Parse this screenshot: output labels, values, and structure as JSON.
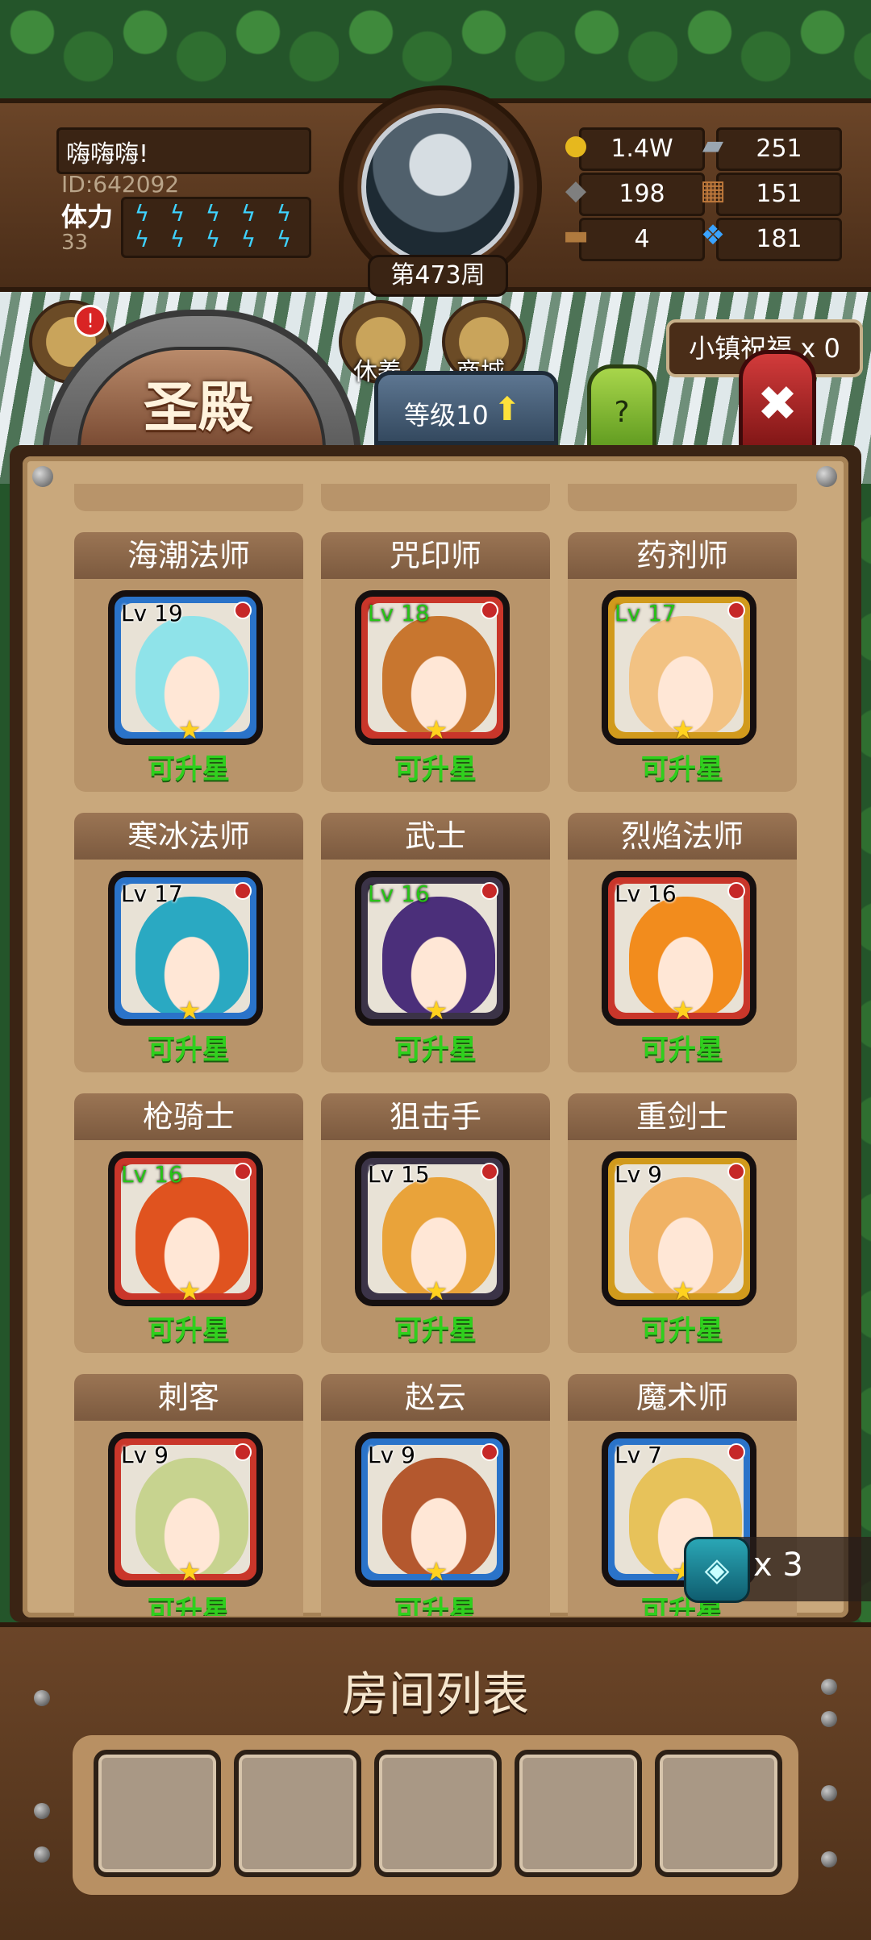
{
  "player": {
    "name": "嗨嗨嗨!",
    "id": "ID:642092",
    "stamina_label": "体力",
    "stamina_value": "33",
    "week_label": "第473周"
  },
  "resources": [
    {
      "icon": "gold-coin-icon",
      "value": "1.4W"
    },
    {
      "icon": "iron-ingot-icon",
      "value": "251"
    },
    {
      "icon": "ore-stone-icon",
      "value": "198"
    },
    {
      "icon": "leather-icon",
      "value": "151"
    },
    {
      "icon": "wood-log-icon",
      "value": "4"
    },
    {
      "icon": "blue-crystal-icon",
      "value": "181"
    }
  ],
  "shortcuts": [
    {
      "icon": "compass-icon",
      "label": "",
      "badge": "!"
    },
    {
      "icon": "scroll-icon",
      "label": "休养"
    },
    {
      "icon": "shop-icon",
      "label": "商城"
    }
  ],
  "blessing": {
    "label": "小镇祝福 x 0"
  },
  "title": "圣殿",
  "level_tab": {
    "label": "等级10"
  },
  "help": {
    "label": "?"
  },
  "close": {
    "label": "✖"
  },
  "heroes": [
    {
      "name": "海潮法师",
      "level": "Lv 19",
      "status": "可升星",
      "frame": "blue",
      "hair": "#8fe3e9",
      "lv_green": false
    },
    {
      "name": "咒印师",
      "level": "Lv 18",
      "status": "可升星",
      "frame": "red",
      "hair": "#c8762f",
      "lv_green": true
    },
    {
      "name": "药剂师",
      "level": "Lv 17",
      "status": "可升星",
      "frame": "gold",
      "hair": "#f2c283",
      "lv_green": true
    },
    {
      "name": "寒冰法师",
      "level": "Lv 17",
      "status": "可升星",
      "frame": "blue",
      "hair": "#2aa9c2",
      "lv_green": false
    },
    {
      "name": "武士",
      "level": "Lv 16",
      "status": "可升星",
      "frame": "purple",
      "hair": "#4b2f7a",
      "lv_green": true
    },
    {
      "name": "烈焰法师",
      "level": "Lv 16",
      "status": "可升星",
      "frame": "red",
      "hair": "#f28c1d",
      "lv_green": false
    },
    {
      "name": "枪骑士",
      "level": "Lv 16",
      "status": "可升星",
      "frame": "red",
      "hair": "#e0531f",
      "lv_green": true
    },
    {
      "name": "狙击手",
      "level": "Lv 15",
      "status": "可升星",
      "frame": "purple",
      "hair": "#e9a33a",
      "lv_green": false
    },
    {
      "name": "重剑士",
      "level": "Lv 9",
      "status": "可升星",
      "frame": "gold",
      "hair": "#f0b264",
      "lv_green": false
    },
    {
      "name": "刺客",
      "level": "Lv 9",
      "status": "可升星",
      "frame": "red",
      "hair": "#c7d38f",
      "lv_green": false
    },
    {
      "name": "赵云",
      "level": "Lv 9",
      "status": "可升星",
      "frame": "blue",
      "hair": "#b4582e",
      "lv_green": false
    },
    {
      "name": "魔术师",
      "level": "Lv 7",
      "status": "可升星",
      "frame": "blue",
      "hair": "#e7c25a",
      "lv_green": false
    }
  ],
  "floating_item": {
    "icon": "rune-stone-icon",
    "count": "x 3"
  },
  "room_list": {
    "title": "房间列表",
    "slot_count": 5
  },
  "colors": {
    "upgrade_green": "#2fd01d",
    "frame_blue": "#2a73c9",
    "frame_red": "#c9362a",
    "frame_gold": "#d19a1c",
    "frame_purple": "#3b3347"
  }
}
